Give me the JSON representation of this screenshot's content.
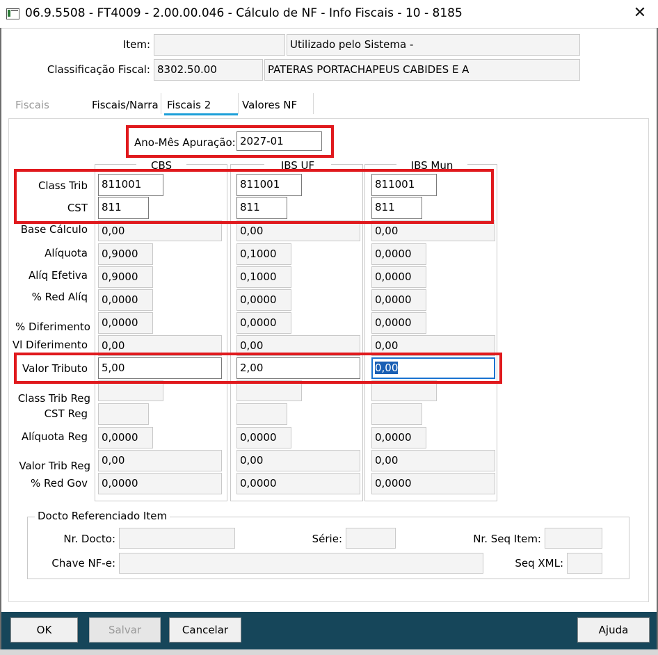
{
  "window": {
    "title": "06.9.5508 - FT4009 - 2.00.00.046 - Cálculo de NF - Info Fiscais - 10 - 8185",
    "close_glyph": "✕"
  },
  "header": {
    "item_label": "Item:",
    "item_code": "",
    "item_desc": "Utilizado pelo Sistema -",
    "class_fiscal_label": "Classificação Fiscal:",
    "class_fiscal_code": "8302.50.00",
    "class_fiscal_desc": "PATERAS PORTACHAPEUS CABIDES E A"
  },
  "tabs": [
    {
      "label": "Fiscais",
      "state": "disabled"
    },
    {
      "label": "Fiscais/Narra",
      "state": "normal"
    },
    {
      "label": "Fiscais 2",
      "state": "active"
    },
    {
      "label": "Valores NF",
      "state": "normal"
    }
  ],
  "apuracao": {
    "label": "Ano-Mês Apuração:",
    "value": "2027-01"
  },
  "row_labels": {
    "class_trib": "Class Trib",
    "cst": "CST",
    "base_calculo": "Base Cálculo",
    "aliquota": "Alíquota",
    "aliq_efetiva": "Alíq Efetiva",
    "red_aliq": "% Red Alíq",
    "diferimento": "% Diferimento",
    "vl_diferimento": "Vl Diferimento",
    "valor_tributo": "Valor Tributo",
    "class_trib_reg": "Class Trib Reg",
    "cst_reg": "CST Reg",
    "aliquota_reg": "Alíquota Reg",
    "valor_trib_reg": "Valor Trib Reg",
    "red_gov": "% Red Gov"
  },
  "columns": [
    {
      "header": "CBS",
      "class_trib": "811001",
      "cst": "811",
      "base_calculo": "0,00",
      "aliquota": "0,9000",
      "aliq_efetiva": "0,9000",
      "red_aliq": "0,0000",
      "diferimento": "0,0000",
      "vl_diferimento": "0,00",
      "valor_tributo": "5,00",
      "class_trib_reg": "",
      "cst_reg": "",
      "aliquota_reg": "0,0000",
      "valor_trib_reg": "0,00",
      "red_gov": "0,0000"
    },
    {
      "header": "IBS UF",
      "class_trib": "811001",
      "cst": "811",
      "base_calculo": "0,00",
      "aliquota": "0,1000",
      "aliq_efetiva": "0,1000",
      "red_aliq": "0,0000",
      "diferimento": "0,0000",
      "vl_diferimento": "0,00",
      "valor_tributo": "2,00",
      "class_trib_reg": "",
      "cst_reg": "",
      "aliquota_reg": "0,0000",
      "valor_trib_reg": "0,00",
      "red_gov": "0,0000"
    },
    {
      "header": "IBS Mun",
      "class_trib": "811001",
      "cst": "811",
      "base_calculo": "0,00",
      "aliquota": "0,0000",
      "aliq_efetiva": "0,0000",
      "red_aliq": "0,0000",
      "diferimento": "0,0000",
      "vl_diferimento": "0,00",
      "valor_tributo": "0,00",
      "class_trib_reg": "",
      "cst_reg": "",
      "aliquota_reg": "0,0000",
      "valor_trib_reg": "0,00",
      "red_gov": "0,0000"
    }
  ],
  "docto_ref": {
    "legend": "Docto Referenciado Item",
    "nr_docto_label": "Nr. Docto:",
    "nr_docto": "",
    "serie_label": "Série:",
    "serie": "",
    "nr_seq_item_label": "Nr. Seq Item:",
    "nr_seq_item": "",
    "chave_nfe_label": "Chave NF-e:",
    "chave_nfe": "",
    "seq_xml_label": "Seq XML:",
    "seq_xml": ""
  },
  "buttons": {
    "ok": "OK",
    "salvar": "Salvar",
    "cancelar": "Cancelar",
    "ajuda": "Ajuda"
  },
  "colors": {
    "highlight": "#e0191d",
    "tab_accent": "#1c9fd8",
    "footer": "#16465a",
    "selection": "#1a5fb4"
  }
}
